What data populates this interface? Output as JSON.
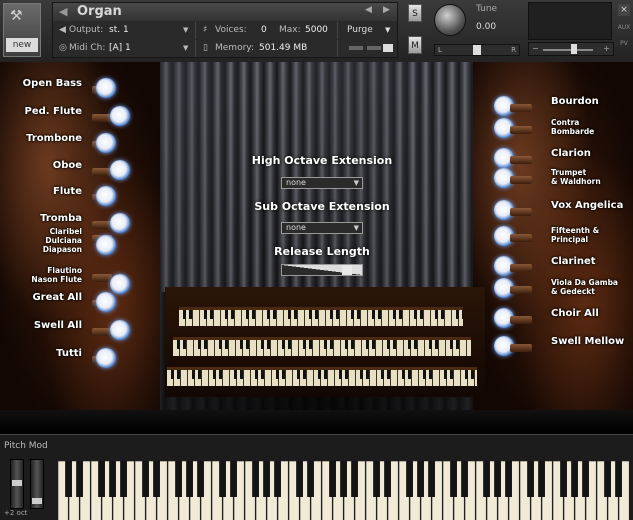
{
  "header": {
    "title": "Organ",
    "new_label": "new",
    "output_label": "Output:",
    "output_value": "st. 1",
    "voices_label": "Voices:",
    "voices_value": "0",
    "max_label": "Max:",
    "max_value": "5000",
    "purge_label": "Purge",
    "midi_label": "Midi Ch:",
    "midi_value": "[A]  1",
    "memory_label": "Memory:",
    "memory_value": "501.49 MB",
    "solo_label": "S",
    "mute_label": "M",
    "tune_label": "Tune",
    "tune_value": "0.00",
    "pan_left": "L",
    "pan_right": "R",
    "vol_minus": "−",
    "vol_plus": "+",
    "aux_label": "AUX",
    "pv_label": "PV"
  },
  "stops_left": [
    {
      "label": "Open Bass"
    },
    {
      "label": "Ped. Flute"
    },
    {
      "label": "Trombone"
    },
    {
      "label": "Oboe"
    },
    {
      "label": "Flute"
    },
    {
      "label": "Tromba"
    },
    {
      "label": "Claribel\nDulciana\nDiapason"
    },
    {
      "label": "Flautino\nNason Flute"
    },
    {
      "label": "Great All"
    },
    {
      "label": "Swell All"
    },
    {
      "label": "Tutti"
    }
  ],
  "stops_right": [
    {
      "label": "Bourdon"
    },
    {
      "label": "Contra\nBombarde"
    },
    {
      "label": "Clarion"
    },
    {
      "label": "Trumpet\n& Waldhorn"
    },
    {
      "label": "Vox Angelica"
    },
    {
      "label": "Fifteenth &\nPrincipal"
    },
    {
      "label": "Clarinet"
    },
    {
      "label": "Viola Da Gamba\n& Gedeckt"
    },
    {
      "label": "Choir All"
    },
    {
      "label": "Swell Mellow"
    }
  ],
  "controls": {
    "high_octave_label": "High Octave Extension",
    "high_octave_value": "none",
    "sub_octave_label": "Sub Octave Extension",
    "sub_octave_value": "none",
    "release_label": "Release Length",
    "release_level": 0.85
  },
  "keyboard": {
    "title": "Pitch  Mod",
    "octave_label": "+2 oct"
  }
}
